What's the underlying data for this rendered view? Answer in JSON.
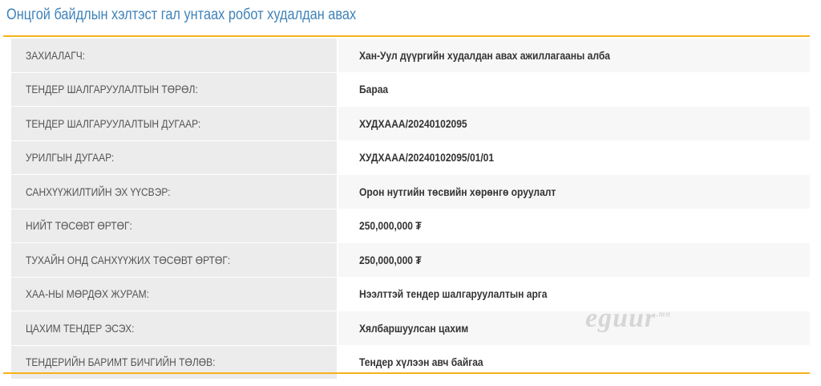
{
  "title": "Онцгой байдлын хэлтэст гал унтаах робот худалдан авах",
  "rows": [
    {
      "label": "ЗАХИАЛАГЧ:",
      "value": "Хан-Уул дүүргийн худалдан авах ажиллагааны алба"
    },
    {
      "label": "ТЕНДЕР ШАЛГАРУУЛАЛТЫН ТӨРӨЛ:",
      "value": "Бараа"
    },
    {
      "label": "ТЕНДЕР ШАЛГАРУУЛАЛТЫН ДУГААР:",
      "value": "ХУДХААА/20240102095"
    },
    {
      "label": "УРИЛГЫН ДУГААР:",
      "value": "ХУДХААА/20240102095/01/01"
    },
    {
      "label": "САНХҮҮЖИЛТИЙН ЭХ ҮҮСВЭР:",
      "value": "Орон нутгийн төсвийн хөрөнгө оруулалт"
    },
    {
      "label": "НИЙТ ТӨСӨВТ ӨРТӨГ:",
      "value": "250,000,000 ₮"
    },
    {
      "label": "ТУХАЙН ОНД САНХҮҮЖИХ ТӨСӨВТ ӨРТӨГ:",
      "value": "250,000,000 ₮"
    },
    {
      "label": "ХАА-НЫ МӨРДӨХ ЖУРАМ:",
      "value": "Нээлттэй тендер шалгаруулалтын арга"
    },
    {
      "label": "ЦАХИМ ТЕНДЕР ЭСЭХ:",
      "value": "Хялбаршуулсан цахим"
    },
    {
      "label": "ТЕНДЕРИЙН БАРИМТ БИЧГИЙН ТӨЛӨВ:",
      "value": "Тендер хүлээн авч байгаа"
    }
  ],
  "watermark": {
    "text": "eguur",
    "suffix": ".mn"
  },
  "colors": {
    "title": "#3f82b9",
    "accent_rule": "#f5b21b",
    "label_bg": "#ececec"
  }
}
